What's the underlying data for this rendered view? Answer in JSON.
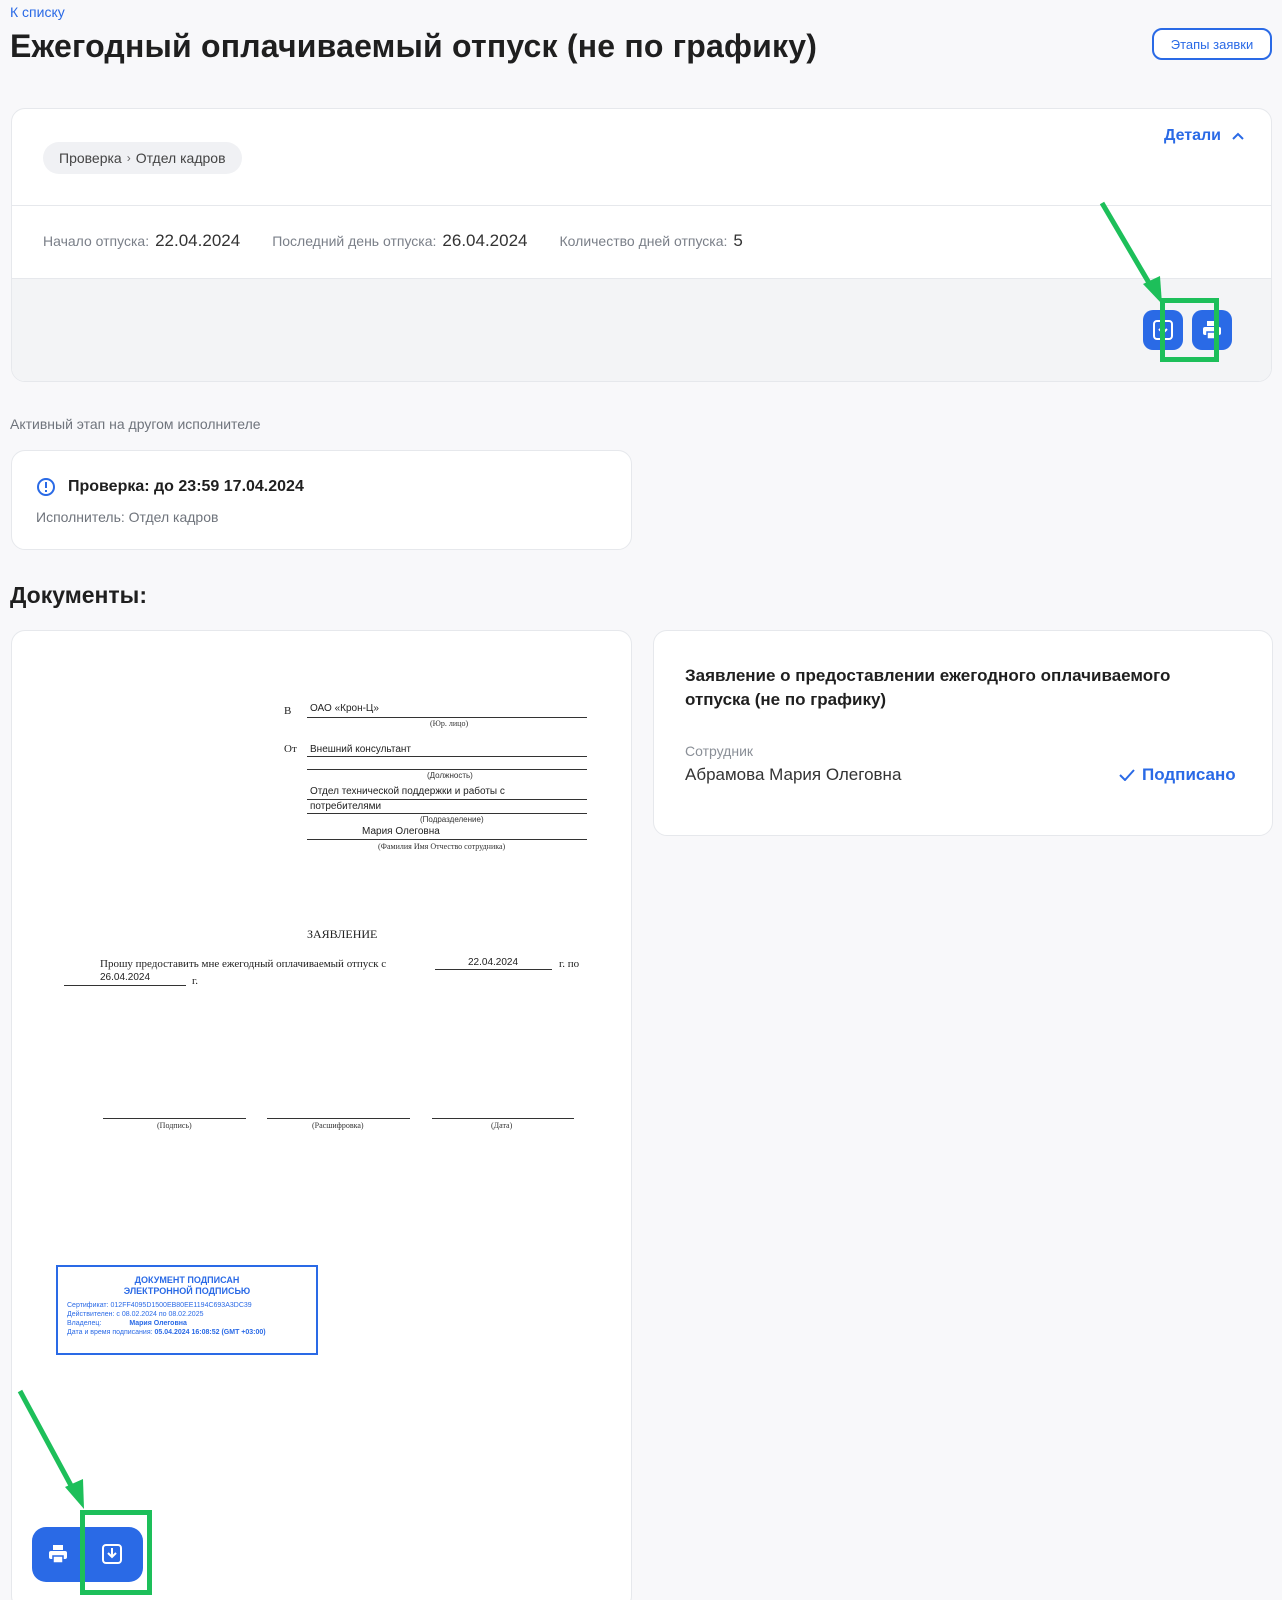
{
  "header": {
    "back_link": "К списку",
    "title": "Ежегодный оплачиваемый отпуск (не по графику)",
    "stages_button": "Этапы заявки"
  },
  "request": {
    "breadcrumb": [
      "Проверка",
      "Отдел кадров"
    ],
    "details_toggle": "Детали",
    "start_label": "Начало отпуска:",
    "start_value": "22.04.2024",
    "end_label": "Последний день отпуска:",
    "end_value": "26.04.2024",
    "days_label": "Количество дней отпуска:",
    "days_value": "5"
  },
  "active_stage": {
    "label": "Активный этап на другом исполнителе",
    "title": "Проверка: до 23:59 17.04.2024",
    "executor": "Исполнитель: Отдел кадров"
  },
  "documents": {
    "heading": "Документы:",
    "doc_title": "Заявление о предоставлении ежегодного оплачиваемого отпуска (не по графику)",
    "employee_label": "Сотрудник",
    "employee_name": "Абрамова Мария Олеговна",
    "status": "Подписано"
  },
  "paper": {
    "to_prefix": "В",
    "to_value": "ОАО «Крон-Ц»",
    "to_caption": "(Юр. лицо)",
    "from_prefix": "От",
    "position_value": "Внешний консультант",
    "position_caption": "(Должность)",
    "dept_line1": "Отдел технической поддержки и работы с",
    "dept_line2": "потребителями",
    "dept_caption": "(Подразделение)",
    "name_value": "Мария Олеговна",
    "name_caption": "(Фамилия Имя Отчество сотрудника)",
    "doc_heading": "ЗАЯВЛЕНИЕ",
    "body_text": "Прошу предоставить мне ежегодный оплачиваемый отпуск с",
    "body_from": "22.04.2024",
    "body_mid": "г. по",
    "body_to": "26.04.2024",
    "body_end": "г.",
    "sig_caption": "(Подпись)",
    "decode_caption": "(Расшифровка)",
    "date_caption": "(Дата)"
  },
  "stamp": {
    "line1": "ДОКУМЕНТ ПОДПИСАН",
    "line2": "ЭЛЕКТРОННОЙ ПОДПИСЬЮ",
    "cert": "Сертификат: 012FF4095D1500EB80EE1194C693A3DC39",
    "valid": "Действителен: с 08.02.2024 по 08.02.2025",
    "owner_label": "Владелец:",
    "owner_value": "Мария Олеговна",
    "signed_label": "Дата и время подписания:",
    "signed_value": "05.04.2024 16:08:52 (GMT +03:00)"
  },
  "colors": {
    "accent": "#2a6ae6",
    "highlight": "#1dbf5a"
  }
}
